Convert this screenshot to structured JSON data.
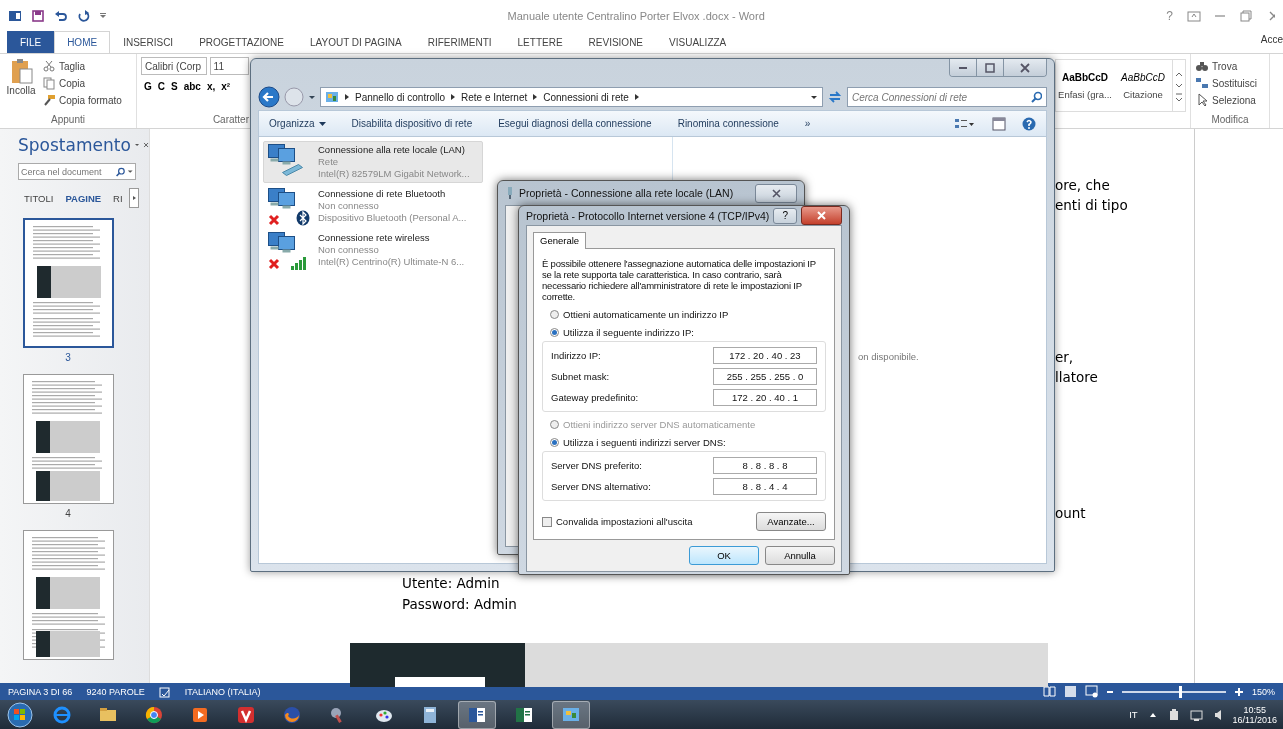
{
  "word": {
    "title": "Manuale utente Centralino Porter Elvox .docx - Word",
    "help": "?",
    "account": "Acce"
  },
  "ribbon_tabs": [
    {
      "label": "FILE",
      "kind": "file",
      "selected": false
    },
    {
      "label": "HOME",
      "kind": "tab",
      "selected": true
    },
    {
      "label": "INSERISCI",
      "kind": "tab",
      "selected": false
    },
    {
      "label": "PROGETTAZIONE",
      "kind": "tab",
      "selected": false
    },
    {
      "label": "LAYOUT DI PAGINA",
      "kind": "tab",
      "selected": false
    },
    {
      "label": "RIFERIMENTI",
      "kind": "tab",
      "selected": false
    },
    {
      "label": "LETTERE",
      "kind": "tab",
      "selected": false
    },
    {
      "label": "REVISIONE",
      "kind": "tab",
      "selected": false
    },
    {
      "label": "VISUALIZZA",
      "kind": "tab",
      "selected": false
    }
  ],
  "ribbon": {
    "clipboard": {
      "paste": "Incolla",
      "items": [
        "Taglia",
        "Copia",
        "Copia formato"
      ],
      "label": "Appunti"
    },
    "font": {
      "font_name": "Calibri (Corp",
      "font_size": "11",
      "buttons": [
        "G",
        "C",
        "S",
        "abc",
        "x,",
        "x²"
      ],
      "label": "Caratter"
    },
    "styles": [
      {
        "sample": "AaBbCcD",
        "name": "Enfasi (gra...",
        "kind": "bold"
      },
      {
        "sample": "AaBbCcD",
        "name": "Citazione",
        "kind": "italic"
      }
    ],
    "editing": {
      "items": [
        "Trova",
        "Sostituisci",
        "Seleziona"
      ],
      "label": "Modifica"
    }
  },
  "navigation": {
    "title": "Spostamento",
    "search_placeholder": "Cerca nel document",
    "tabs": [
      {
        "label": "TITOLI",
        "selected": false
      },
      {
        "label": "PAGINE",
        "selected": true
      },
      {
        "label": "RI",
        "selected": false
      }
    ],
    "pages": [
      {
        "number": "3",
        "selected": true
      },
      {
        "number": "4",
        "selected": false
      },
      {
        "selected": false
      }
    ]
  },
  "document": {
    "fragments": [
      [
        "ore, che",
        "enti di tipo"
      ],
      [
        "er,",
        "llatore"
      ],
      [
        "ount"
      ]
    ],
    "credentials": [
      "Utente: Admin",
      "Password: Admin"
    ]
  },
  "explorer": {
    "breadcrumbs": [
      "Pannello di controllo",
      "Rete e Internet",
      "Connessioni di rete"
    ],
    "search_placeholder": "Cerca Connessioni di rete",
    "commands": [
      {
        "label": "Organizza",
        "menu": true
      },
      {
        "label": "Disabilita dispositivo di rete",
        "menu": false
      },
      {
        "label": "Esegui diagnosi della connessione",
        "menu": false
      },
      {
        "label": "Rinomina connessione",
        "menu": false
      },
      {
        "label": "»",
        "menu": false
      }
    ],
    "connections": [
      {
        "name": "Connessione alla rete locale (LAN)",
        "status": "Rete",
        "device": "Intel(R) 82579LM Gigabit Network...",
        "kind": "lan",
        "disconnected": false,
        "selected": true
      },
      {
        "name": "Connessione di rete Bluetooth",
        "status": "Non connesso",
        "device": "Dispositivo Bluetooth (Personal A...",
        "kind": "bluetooth",
        "disconnected": true,
        "selected": false
      },
      {
        "name": "Connessione rete wireless",
        "status": "Non connesso",
        "device": "Intel(R) Centrino(R) Ultimate-N 6...",
        "kind": "wireless",
        "disconnected": true,
        "selected": false
      }
    ],
    "details_text": "on disponibile."
  },
  "lan_dialog": {
    "title": "Proprietà - Connessione alla rete locale (LAN)"
  },
  "tcp_dialog": {
    "title": "Proprietà - Protocollo Internet versione 4 (TCP/IPv4)",
    "help": "?",
    "tabs": [
      {
        "label": "Generale",
        "selected": true
      }
    ],
    "description": "È possibile ottenere l'assegnazione automatica delle impostazioni IP se la rete supporta tale caratteristica. In caso contrario, sarà necessario richiedere all'amministratore di rete le impostazioni IP corrette.",
    "sections": [
      {
        "auto": {
          "label": "Ottieni automaticamente un indirizzo IP",
          "selected": false,
          "disabled": false
        },
        "manual": {
          "label": "Utilizza il seguente indirizzo IP:",
          "selected": true
        },
        "fields": [
          {
            "label": "Indirizzo IP:",
            "value": "172 . 20 . 40 . 23"
          },
          {
            "label": "Subnet mask:",
            "value": "255 . 255 . 255 . 0"
          },
          {
            "label": "Gateway predefinito:",
            "value": "172 . 20 . 40 . 1"
          }
        ]
      },
      {
        "auto": {
          "label": "Ottieni indirizzo server DNS automaticamente",
          "selected": false,
          "disabled": true
        },
        "manual": {
          "label": "Utilizza i seguenti indirizzi server DNS:",
          "selected": true
        },
        "fields": [
          {
            "label": "Server DNS preferito:",
            "value": "8 . 8 . 8 . 8"
          },
          {
            "label": "Server DNS alternativo:",
            "value": "8 . 8 . 4 . 4"
          }
        ]
      }
    ],
    "validate": {
      "label": "Convalida impostazioni all'uscita",
      "checked": false
    },
    "advanced": "Avanzate...",
    "ok": "OK",
    "cancel": "Annulla"
  },
  "status_bar": {
    "page": "PAGINA 3 DI 66",
    "words": "9240 PAROLE",
    "language": "ITALIANO (ITALIA)",
    "zoom_slider": {
      "level": 0.55
    },
    "zoom": "150%"
  },
  "taskbar": {
    "apps": [
      {
        "kind": "ie",
        "active": false
      },
      {
        "kind": "folder",
        "active": false
      },
      {
        "kind": "chrome",
        "active": false
      },
      {
        "kind": "media",
        "active": false
      },
      {
        "kind": "vivaldi",
        "active": false
      },
      {
        "kind": "firefox",
        "active": false
      },
      {
        "kind": "tool",
        "active": false
      },
      {
        "kind": "paint",
        "active": false
      },
      {
        "kind": "calculator",
        "active": false
      },
      {
        "kind": "word",
        "active": true
      },
      {
        "kind": "excel",
        "active": false
      },
      {
        "kind": "control",
        "active": true
      }
    ],
    "language": "IT",
    "time": "10:55",
    "date": "16/11/2016"
  }
}
